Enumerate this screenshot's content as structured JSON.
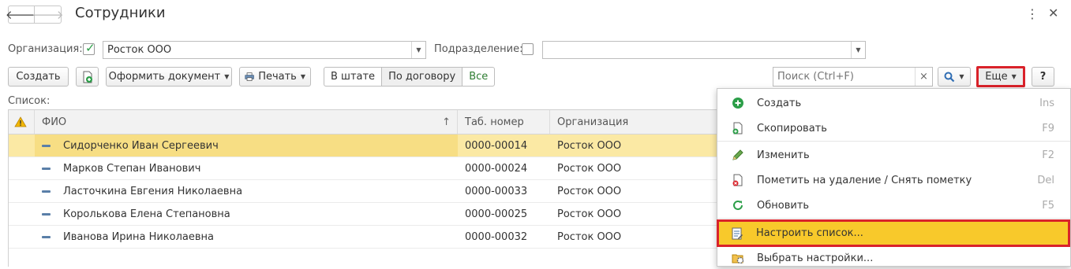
{
  "window": {
    "title": "Сотрудники",
    "back_glyph": "🡐",
    "forward_glyph": "🡒",
    "more_glyph": "⋮",
    "close_glyph": "✕"
  },
  "filters": {
    "org_label": "Организация:",
    "org_checked": true,
    "org_value": "Росток ООО",
    "dept_label": "Подразделение:",
    "dept_checked": false,
    "dept_value": ""
  },
  "toolbar": {
    "create_label": "Создать",
    "create_copy_icon": "document-add-icon",
    "make_doc_label": "Оформить документ",
    "print_label": "Печать",
    "seg_staff": "В штате",
    "seg_contract": "По договору",
    "seg_all": "Все",
    "search_placeholder": "Поиск (Ctrl+F)",
    "search_clear": "×",
    "more_label": "Еще",
    "help_label": "?"
  },
  "list": {
    "label": "Список:",
    "columns": [
      "ФИО",
      "Таб. номер",
      "Организация"
    ],
    "sort_glyph": "↑",
    "rows": [
      {
        "fio": "Сидорченко Иван Сергеевич",
        "tab": "0000-00014",
        "org": "Росток ООО",
        "selected": true
      },
      {
        "fio": "Марков Степан Иванович",
        "tab": "0000-00024",
        "org": "Росток ООО",
        "selected": false
      },
      {
        "fio": "Ласточкина Евгения Николаевна",
        "tab": "0000-00033",
        "org": "Росток ООО",
        "selected": false
      },
      {
        "fio": "Королькова Елена Степановна",
        "tab": "0000-00025",
        "org": "Росток ООО",
        "selected": false
      },
      {
        "fio": "Иванова Ирина Николаевна",
        "tab": "0000-00032",
        "org": "Росток ООО",
        "selected": false
      }
    ]
  },
  "menu": {
    "items": [
      {
        "label": "Создать",
        "shortcut": "Ins",
        "icon": "plus-circle-icon"
      },
      {
        "label": "Скопировать",
        "shortcut": "F9",
        "icon": "copy-document-icon"
      },
      {
        "label": "Изменить",
        "shortcut": "F2",
        "icon": "pencil-icon"
      },
      {
        "label": "Пометить на удаление / Снять пометку",
        "shortcut": "Del",
        "icon": "delete-mark-icon"
      },
      {
        "label": "Обновить",
        "shortcut": "F5",
        "icon": "refresh-icon"
      },
      {
        "label": "Настроить список...",
        "shortcut": "",
        "icon": "list-settings-icon"
      },
      {
        "label": "Выбрать настройки...",
        "shortcut": "",
        "icon": "choose-settings-icon"
      }
    ]
  },
  "colors": {
    "selected_row": "#fbe9a4",
    "highlight_item": "#f8c92b",
    "highlight_border": "#d9222a",
    "accent_green": "#2b9e48"
  }
}
